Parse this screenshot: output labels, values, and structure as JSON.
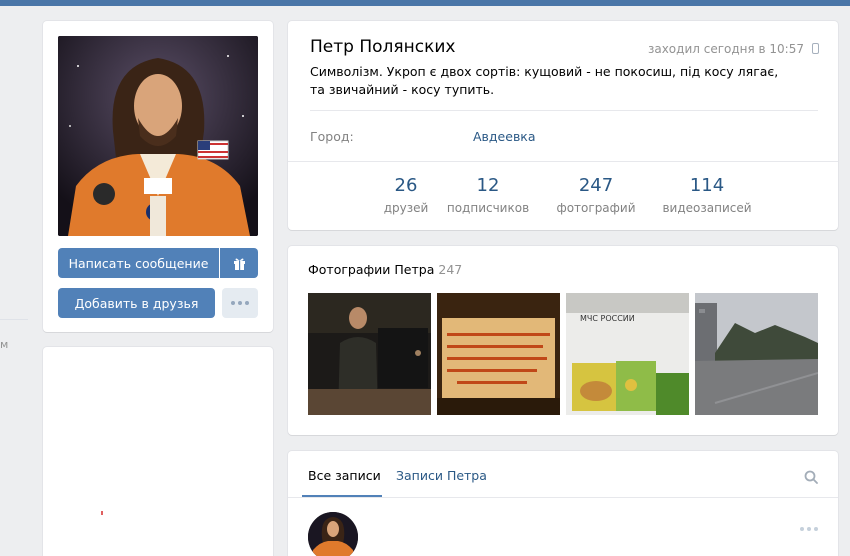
{
  "profile": {
    "name": "Петр Полянских",
    "last_seen": "заходил сегодня в 10:57",
    "status": "Символізм. Укроп є двох сортів: кущовий - не покосиш, під косу лягає, та звичайний - косу тупить.",
    "city_label": "Город:",
    "city_value": "Авдеевка"
  },
  "actions": {
    "write_message": "Написать сообщение",
    "add_friend": "Добавить в друзья"
  },
  "counters": [
    {
      "value": "26",
      "label": "друзей"
    },
    {
      "value": "12",
      "label": "подписчиков"
    },
    {
      "value": "247",
      "label": "фотографий"
    },
    {
      "value": "114",
      "label": "видеозаписей"
    }
  ],
  "photos": {
    "title": "Фотографии Петра",
    "count": "247",
    "photo3_caption": "МЧС РОССИИ"
  },
  "wall": {
    "tab_all": "Все записи",
    "tab_owner": "Записи Петра"
  },
  "sidebar_edge_glyph": "м",
  "colors": {
    "accent": "#5181b8",
    "link": "#2a5885",
    "header": "#4a76a8",
    "muted": "#828282"
  },
  "icons": [
    "gift-icon",
    "more-icon",
    "phone-icon",
    "search-icon"
  ]
}
